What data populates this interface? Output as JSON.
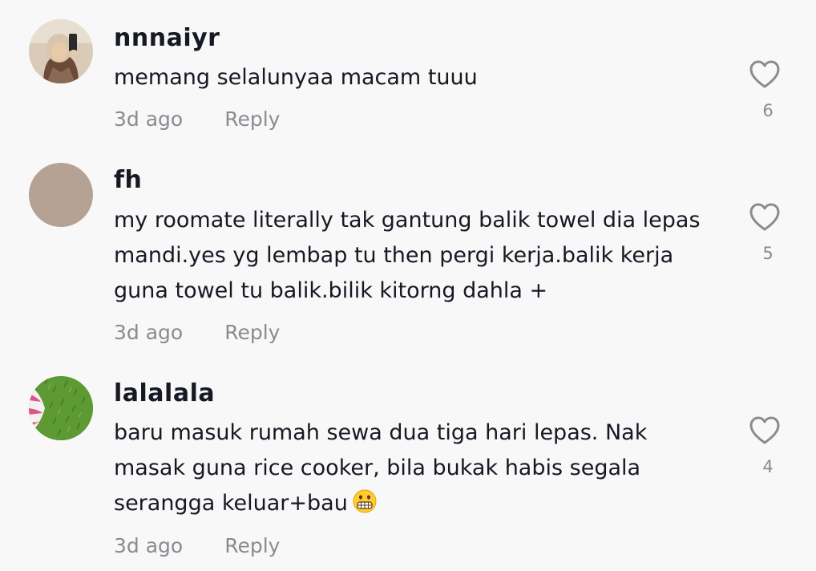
{
  "comments": [
    {
      "username": "nnnaiyr",
      "text": "memang selalunyaa macam tuuu",
      "time": "3d ago",
      "reply_label": "Reply",
      "likes": "6",
      "avatar_icon": "user-photo-avatar"
    },
    {
      "username": "fh",
      "text": "my roomate literally tak gantung balik towel dia lepas mandi.yes yg lembap tu then pergi kerja.balik kerja guna towel tu balik.bilik kitorng dahla +",
      "time": "3d ago",
      "reply_label": "Reply",
      "likes": "5",
      "avatar_color": "#b5a295"
    },
    {
      "username": "lalalala",
      "text": "baru masuk rumah sewa dua tiga hari lepas. Nak masak guna rice cooker, bila bukak habis segala serangga keluar+bau",
      "emoji": "grimacing-face-icon",
      "time": "3d ago",
      "reply_label": "Reply",
      "likes": "4",
      "avatar_icon": "grass-photo-avatar"
    }
  ],
  "colors": {
    "background": "#f8f8f8",
    "text_primary": "#161823",
    "text_secondary": "#8a8b91"
  }
}
